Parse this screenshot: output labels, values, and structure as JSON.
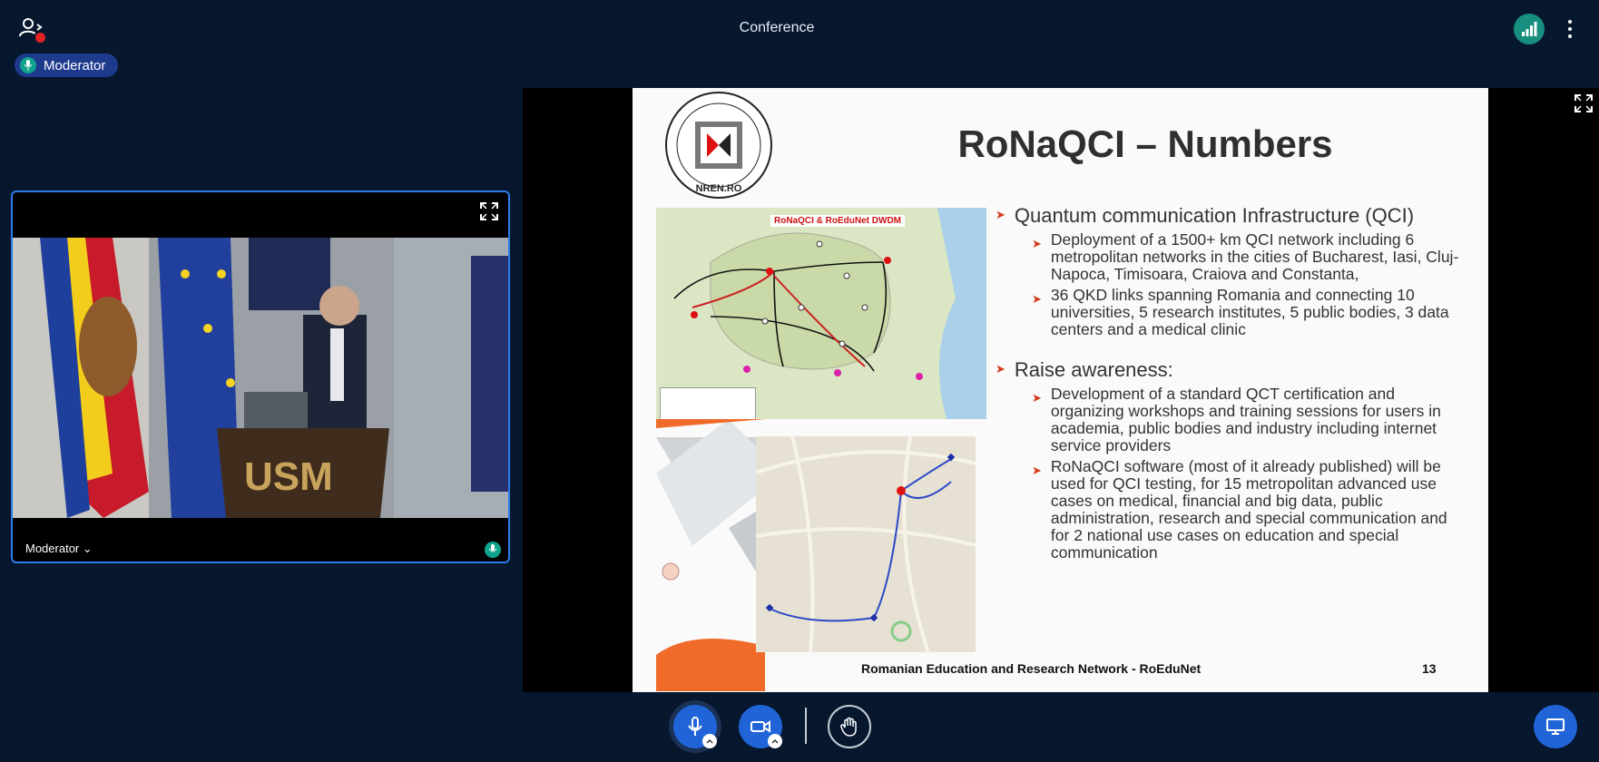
{
  "header": {
    "title": "Conference",
    "users_icon": "users-icon",
    "signal_icon": "signal-icon",
    "more_icon": "more-options-icon"
  },
  "presenter_pill": {
    "label": "Moderator"
  },
  "webcam": {
    "name": "Moderator ⌄",
    "podium_text": "USM"
  },
  "slide": {
    "title": "RoNaQCI – Numbers",
    "logo_text": "NREN.RO",
    "map1_label": "RoNaQCI & RoEduNet DWDM",
    "bullets": [
      {
        "text": "Quantum communication Infrastructure (QCI)",
        "sub": [
          "Deployment of a 1500+ km QCI network including 6 metropolitan networks in the cities of Bucharest, Iasi, Cluj-Napoca, Timisoara, Craiova and Constanta,",
          "36 QKD links spanning Romania and connecting 10 universities, 5 research institutes, 5 public bodies, 3 data centers and a medical clinic"
        ]
      },
      {
        "text": "Raise awareness:",
        "sub": [
          "Development of a standard QCT certification and organizing workshops and training sessions for users in academia, public bodies and industry including internet service providers",
          "RoNaQCI software (most of it already published) will be used for QCI testing, for 15 metropolitan advanced use cases on medical, financial and big data, public administration, research and special communication and for 2 national use cases on education and special communication"
        ]
      }
    ],
    "footer": "Romanian Education and Research Network - RoEduNet",
    "page_number": "13"
  },
  "colors": {
    "background": "#06172e",
    "accent_blue": "#2064d8",
    "signal_green": "#188e7f",
    "alert_red": "#e32222",
    "bullet_arrow": "#d43a1a"
  }
}
